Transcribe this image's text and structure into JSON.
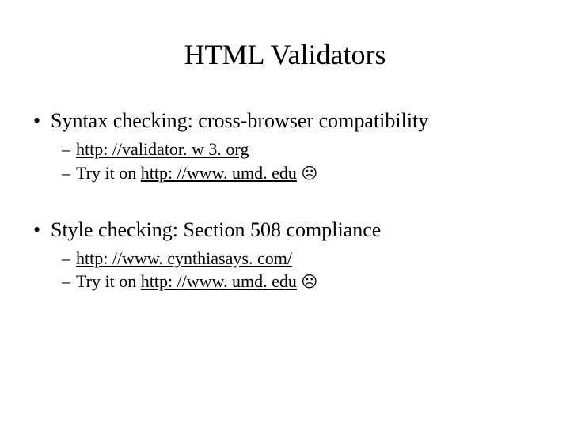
{
  "slide": {
    "title": "HTML Validators",
    "sections": [
      {
        "heading": "Syntax checking: cross-browser compatibility",
        "subitems": [
          {
            "text_before": "",
            "link": "http: //validator. w 3. org",
            "text_after": ""
          },
          {
            "text_before": "Try it on ",
            "link": "http: //www. umd. edu",
            "text_after": " ",
            "emoji": "☹"
          }
        ]
      },
      {
        "heading": "Style checking: Section 508 compliance",
        "subitems": [
          {
            "text_before": "",
            "link": "http: //www. cynthiasays. com/",
            "text_after": ""
          },
          {
            "text_before": "Try it on ",
            "link": "http: //www. umd. edu",
            "text_after": " ",
            "emoji": "☹"
          }
        ]
      }
    ]
  }
}
